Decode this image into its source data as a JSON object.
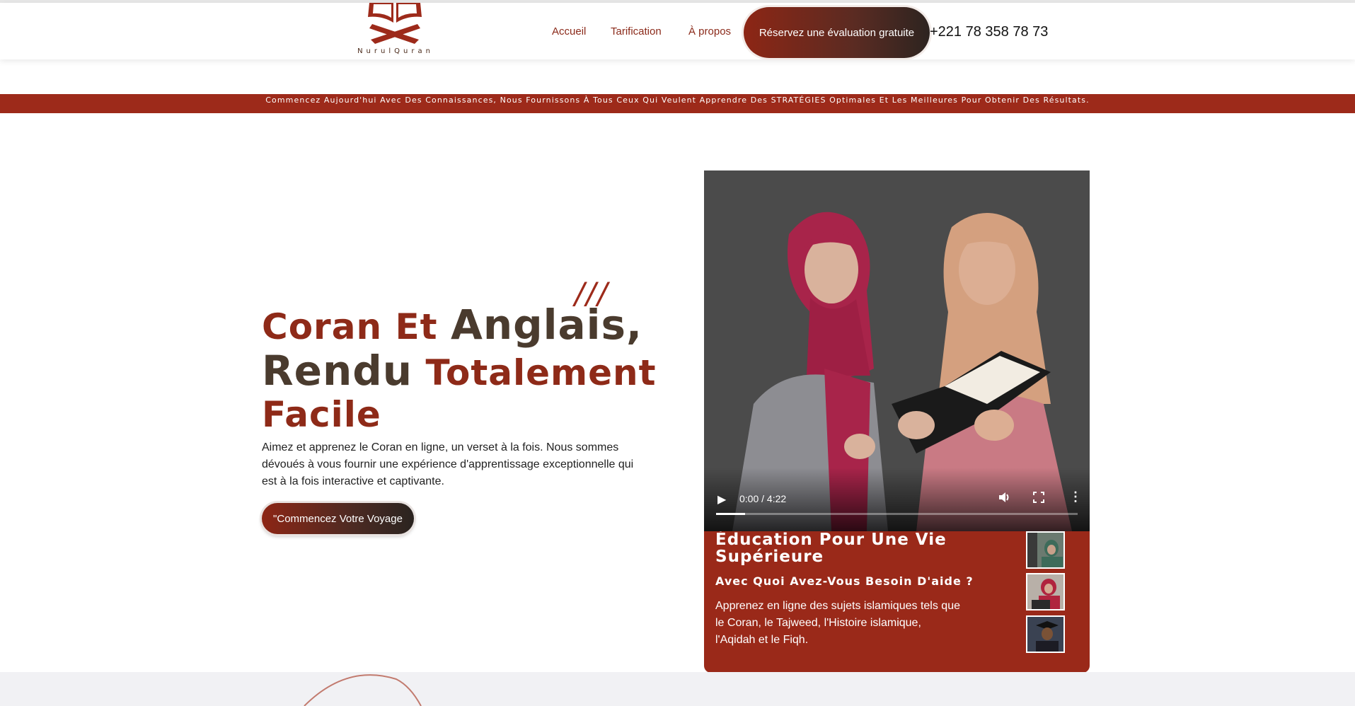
{
  "brand": {
    "name": "NurulQuran",
    "primary_color": "#9d2a1a",
    "dark_color": "#4a3b2e"
  },
  "nav": {
    "items": [
      {
        "label": "Accueil"
      },
      {
        "label": "Tarification"
      },
      {
        "label": "À propos"
      }
    ],
    "cta_label": "Réservez une évaluation gratuite",
    "phone": "+221 78 358 78 73"
  },
  "banner": {
    "text": "Commencez Aujourd'hui Avec Des Connaissances, Nous Fournissons À Tous Ceux Qui Veulent Apprendre Des STRATÉGIES Optimales Et Les Meilleures Pour Obtenir Des Résultats."
  },
  "hero": {
    "decoration": "///",
    "headline": {
      "w1": "Coran Et",
      "w2": "Anglais,",
      "w3": "Rendu",
      "w4": "Totalement",
      "w5": "Facile"
    },
    "description": "Aimez et apprenez le Coran en ligne, un verset à la fois. Nous sommes dévoués à vous fournir une expérience d'apprentissage exceptionnelle qui est à la fois interactive et captivante.",
    "cta_label": "\"Commencez Votre Voyage"
  },
  "video": {
    "time": "0:00 / 4:22",
    "progress": 0.08,
    "icons": [
      "play-icon",
      "volume-icon",
      "fullscreen-icon",
      "more-icon"
    ]
  },
  "card": {
    "title": "Éducation Pour Une Vie Supérieure",
    "subtitle": "Avec Quoi Avez-Vous Besoin D'aide ?",
    "text": "Apprenez en ligne des sujets islamiques tels que le Coran, le Tajweed, l'Histoire islamique, l'Aqidah et le Fiqh."
  }
}
